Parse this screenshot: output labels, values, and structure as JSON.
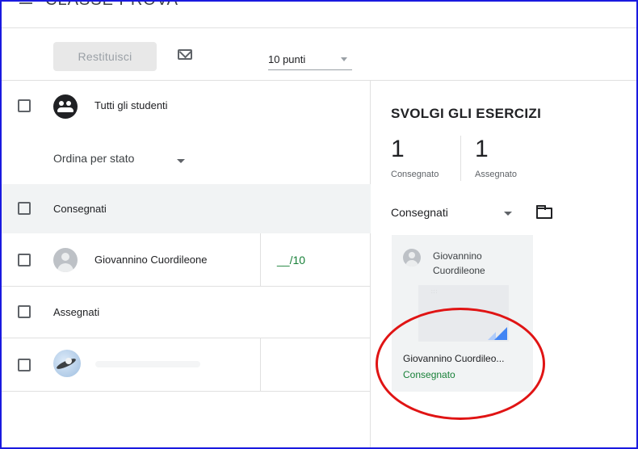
{
  "header": {
    "class_title": "CLASSE PROVA"
  },
  "toolbar": {
    "return_label": "Restituisci",
    "points_value": "10 punti"
  },
  "students_panel": {
    "all_students_label": "Tutti gli studenti",
    "sort_label": "Ordina per stato",
    "sections": {
      "turned_in": "Consegnati",
      "assigned": "Assegnati"
    },
    "turned_in_students": [
      {
        "name": "Giovannino Cuordileone",
        "grade": "__/10"
      }
    ]
  },
  "assignment": {
    "title": "SVOLGI GLI ESERCIZI",
    "stats": [
      {
        "number": "1",
        "label": "Consegnato"
      },
      {
        "number": "1",
        "label": "Assegnato"
      }
    ],
    "filter_value": "Consegnati",
    "card": {
      "student_name": "Giovannino Cuordileone",
      "file_name": "Giovannino Cuordileo...",
      "status": "Consegnato"
    }
  },
  "colors": {
    "accent_green": "#188038",
    "highlight_red": "#e01414",
    "frame_blue": "#1a1ae0"
  }
}
